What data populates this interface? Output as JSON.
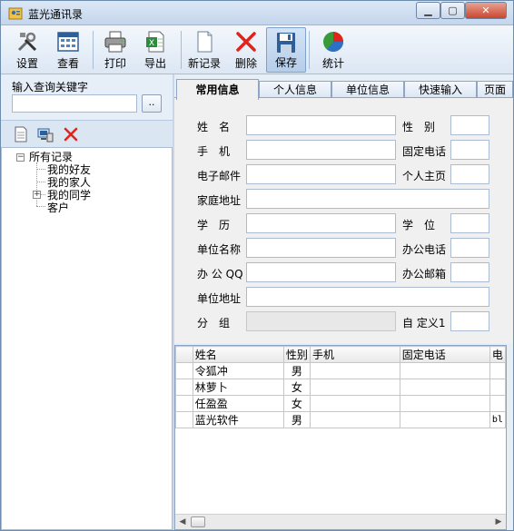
{
  "window": {
    "title": "蓝光通讯录"
  },
  "toolbar": {
    "settings": "设置",
    "view": "查看",
    "print": "打印",
    "export": "导出",
    "new_record": "新记录",
    "delete": "删除",
    "save": "保存",
    "stats": "统计"
  },
  "search": {
    "label": "输入查询关键字",
    "value": "",
    "button": ".."
  },
  "tree": {
    "root": "所有记录",
    "children": [
      "我的好友",
      "我的家人",
      "我的同学",
      "客户"
    ]
  },
  "tabs": [
    "常用信息",
    "个人信息",
    "单位信息",
    "快速输入",
    "页面"
  ],
  "form": {
    "name": "姓　名",
    "gender": "性　别",
    "mobile": "手　机",
    "phone": "固定电话",
    "email": "电子邮件",
    "homepage": "个人主页",
    "home_address": "家庭地址",
    "education": "学　历",
    "degree": "学　位",
    "company": "单位名称",
    "work_phone": "办公电话",
    "work_qq": "办 公 QQ",
    "work_email": "办公邮箱",
    "company_address": "单位地址",
    "group": "分　组",
    "custom1": "自 定义1"
  },
  "grid": {
    "columns": [
      "姓名",
      "性别",
      "手机",
      "固定电话",
      "电"
    ],
    "rows": [
      [
        "令狐冲",
        "男",
        "",
        "",
        ""
      ],
      [
        "林萝卜",
        "女",
        "",
        "",
        ""
      ],
      [
        "任盈盈",
        "女",
        "",
        "",
        ""
      ],
      [
        "蓝光软件",
        "男",
        "",
        "",
        "bl"
      ]
    ]
  },
  "colors": {
    "accent": "#3a6ea5",
    "delete": "#e0241b"
  }
}
